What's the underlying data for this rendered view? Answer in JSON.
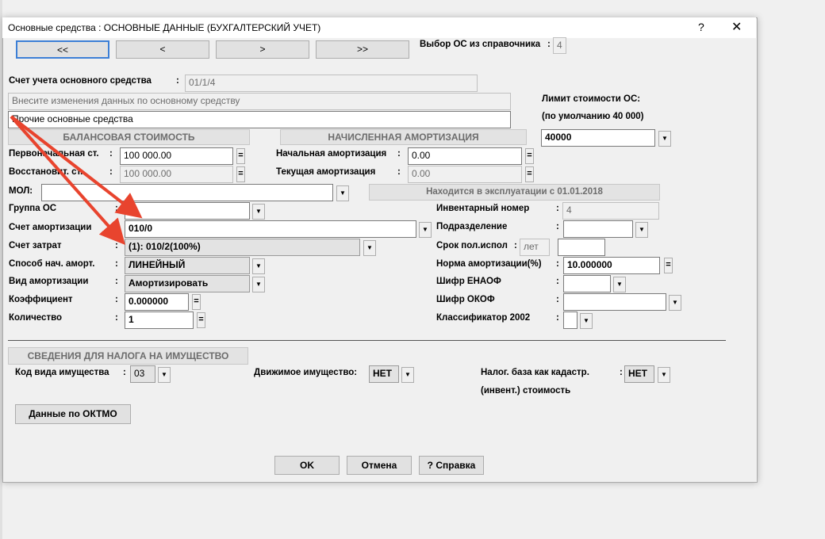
{
  "window": {
    "title": "Основные средства : ОСНОВНЫЕ ДАННЫЕ (БУХГАЛТЕРСКИЙ УЧЕТ)",
    "help": "?",
    "close": "✕"
  },
  "nav": {
    "first": "<<",
    "prev": "<",
    "next": ">",
    "last": ">>",
    "pick_label": "Выбор ОС из справочника",
    "pick_value": "4"
  },
  "account": {
    "label": "Счет учета основного средства",
    "value": "01/1/4"
  },
  "changes_hint": "Внесите изменения данных по основному средству",
  "asset_name": "Прочие основные средства",
  "limit": {
    "label1": "Лимит стоимости ОС:",
    "label2": "(по умолчанию 40 000)",
    "value": "40000"
  },
  "balance": {
    "header": "БАЛАНСОВАЯ СТОИМОСТЬ",
    "initial_label": "Первоначальная ст.",
    "initial_value": "100 000.00",
    "restore_label": "Восстановит.   ст.",
    "restore_value": "100 000.00"
  },
  "amort": {
    "header": "НАЧИСЛЕННАЯ АМОРТИЗАЦИЯ",
    "initial_label": "Начальная амортизация",
    "initial_value": "0.00",
    "current_label": "Текущая    амортизация",
    "current_value": "0.00"
  },
  "mol": {
    "label": "МОЛ:",
    "value": ""
  },
  "in_use": "Находится в эксплуатации с 01.01.2018",
  "fields": {
    "group_label": "Группа ОС",
    "group_value": "",
    "amort_account_label": "Счет амортизации",
    "amort_account_value": "010/0",
    "cost_account_label": "Счет затрат",
    "cost_account_value": "(1): 010/2(100%)",
    "method_label": "Способ нач. аморт.",
    "method_value": "ЛИНЕЙНЫЙ",
    "kind_label": "Вид амортизации",
    "kind_value": "Амортизировать",
    "coef_label": "Коэффициент",
    "coef_value": "0.000000",
    "qty_label": "Количество",
    "qty_value": "1"
  },
  "right": {
    "inv_label": "Инвентарный номер",
    "inv_value": "4",
    "div_label": "Подразделение",
    "div_value": "",
    "term_label": "Срок пол.испол",
    "term_unit": "лет",
    "term_value": "",
    "norm_label": "Норма амортизации(%)",
    "norm_value": "10.000000",
    "enaof_label": "Шифр ЕНАОФ",
    "enaof_value": "",
    "okof_label": "Шифр ОКОФ",
    "okof_value": "",
    "class_label": "Классификатор 2002",
    "class_value": ""
  },
  "tax": {
    "header": "СВЕДЕНИЯ ДЛЯ НАЛОГА НА ИМУЩЕСТВО",
    "kind_label": "Код вида имущества",
    "kind_value": "03",
    "movable_label": "Движимое имущество:",
    "movable_value": "НЕТ",
    "base_label1": "Налог. база как кадастр.",
    "base_label2": "(инвент.) стоимость",
    "base_value": "НЕТ",
    "oktmo_button": "Данные по ОКТМО"
  },
  "footer": {
    "ok": "OK",
    "cancel": "Отмена",
    "help": "? Справка"
  },
  "colors": {
    "arrow": "#e8442e",
    "window_bg": "#f0f0f0"
  }
}
